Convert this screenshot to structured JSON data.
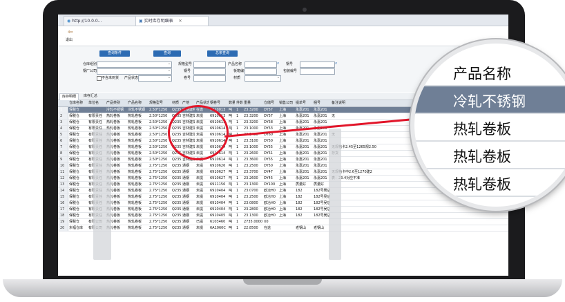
{
  "tabs": [
    {
      "label": "http://10.0.0..."
    },
    {
      "label": "实时库存明细表"
    }
  ],
  "toolbar": {
    "exit_label": "退出"
  },
  "filter": {
    "buttons": {
      "query": "查询条件",
      "search": "查询",
      "summary": "总条查询"
    },
    "labels": {
      "warehouse": "仓库组别",
      "mill": "钢厂公司",
      "spec": "规格型号",
      "product": "产品名称",
      "status": "产品状态",
      "steel_grade": "钢号",
      "coil_no": "卷号",
      "material": "材质",
      "carton": "板箱编号",
      "package": "包装编号",
      "only_available": "不含未到货"
    }
  },
  "grid": {
    "tabs": [
      "库存明细",
      "库存汇总"
    ],
    "headers": [
      "仓库名称",
      "单位名",
      "产品类别",
      "产品名称",
      "规格型号",
      "材质",
      "产地",
      "产品状态",
      "钢卷号",
      "数量",
      "件数",
      "重量",
      "仓储号",
      "销售公司",
      "提单号",
      "捆号",
      "备注说明"
    ],
    "rows": [
      [
        "保税仓",
        "",
        "冷轧不锈钢",
        "冷轧不锈钢",
        "2.50*1250",
        "Q235",
        "宝钢建邦",
        "在途",
        "6910013",
        "吨",
        "1",
        "23.3200",
        "DY57",
        "上海",
        "永嘉201",
        "永嘉201",
        ""
      ],
      [
        "保税仓",
        "有限责任",
        "热轧卷板",
        "热轧卷板",
        "2.50*1250",
        "Q235",
        "吉林建龙",
        "未提",
        "6910613",
        "吨",
        "1",
        "23.3200",
        "DY57",
        "上海",
        "永嘉201",
        "永嘉201",
        "无"
      ],
      [
        "保税仓",
        "有限责任",
        "热轧卷板",
        "热轧卷板",
        "2.50*1250",
        "Q235",
        "吉林建龙",
        "未提",
        "6910613",
        "吨",
        "1",
        "23.3200",
        "DY58",
        "上海",
        "永嘉201",
        "永嘉201",
        ""
      ],
      [
        "保税仓",
        "有限责任",
        "热轧卷板",
        "热轧卷板",
        "2.50*1250",
        "Q235",
        "吉林建龙",
        "未提",
        "6910614",
        "吨",
        "1",
        "23.1000",
        "DY53",
        "上海",
        "永嘉201",
        "永嘉201",
        ""
      ],
      [
        "保税仓",
        "有限责任",
        "热轧卷板",
        "热轧卷板",
        "2.50*1250",
        "Q235",
        "吉林建龙",
        "未提",
        "6910614",
        "吨",
        "1",
        "23.3400",
        "DY60",
        "上海",
        "永嘉201",
        "永嘉201",
        "无"
      ],
      [
        "保税仓",
        "有限责任",
        "热轧卷板",
        "热轧卷板",
        "2.50*1250",
        "Q235",
        "吉林建龙",
        "未提",
        "6910614",
        "吨",
        "1",
        "23.3100",
        "DY50",
        "上海",
        "永嘉201",
        "永嘉201",
        ""
      ],
      [
        "保税仓",
        "有限责任",
        "热轧卷板",
        "热轧卷板",
        "2.50*1250",
        "Q235",
        "吉林建龙",
        "未提",
        "6910614",
        "吨",
        "1",
        "23.1000",
        "DY55",
        "上海",
        "永嘉201",
        "永嘉201",
        "无规格卡2.45至1265规2.50"
      ],
      [
        "保税仓",
        "有限责任",
        "热轧卷板",
        "热轧卷板",
        "2.50*1250",
        "Q235",
        "吉林建龙",
        "未提",
        "6910614",
        "吨",
        "1",
        "23.2600",
        "DY51",
        "上海",
        "永嘉201",
        "永嘉201",
        "存货"
      ],
      [
        "保税仓",
        "有限责任",
        "热轧卷板",
        "热轧卷板",
        "2.50*1250",
        "Q235",
        "吉林建龙",
        "未提",
        "6910614",
        "吨",
        "1",
        "23.3600",
        "DY55",
        "上海",
        "永嘉201",
        "永嘉201",
        ""
      ],
      [
        "保税仓",
        "有限责任",
        "热轧卷板",
        "热轧卷板",
        "2.75*1250",
        "Q235",
        "通钢",
        "未提",
        "6910626",
        "吨",
        "1",
        "23.2500",
        "DY50",
        "上海",
        "永嘉201",
        "永嘉201",
        ""
      ],
      [
        "保税仓",
        "有限责任",
        "热轧卷板",
        "热轧卷板",
        "2.75*1250",
        "Q235",
        "通钢",
        "未提",
        "6910627",
        "吨",
        "1",
        "23.3700",
        "DY47",
        "上海",
        "永嘉201",
        "永嘉201",
        "无规格卡中2.6至1270建2"
      ],
      [
        "保税仓",
        "有限责任",
        "热轧卷板",
        "热轧卷板",
        "2.75*1250",
        "Q235",
        "通钢",
        "未提",
        "6910627",
        "吨",
        "1",
        "23.2600",
        "DY45",
        "上海",
        "永嘉201",
        "永嘉201",
        "表：23.4对应不准"
      ],
      [
        "保税仓",
        "有限责任",
        "热轧卷板",
        "热轧卷板",
        "2.75*1250",
        "Q235",
        "通钢",
        "未提",
        "6911156",
        "吨",
        "1",
        "23.1300",
        "DY100",
        "上海",
        "质量好",
        "质量好",
        ""
      ],
      [
        "保税仓",
        "有限责任",
        "热轧卷板",
        "热轧卷板",
        "2.75*1250",
        "Q235",
        "通钢",
        "未提",
        "6910404",
        "吨",
        "1",
        "23.0700",
        "欧冶H0",
        "上海",
        "182",
        "182号吴店",
        ""
      ],
      [
        "保税仓",
        "有限责任",
        "热轧卷板",
        "热轧卷板",
        "2.75*1250",
        "Q235",
        "通钢",
        "未提",
        "6910404",
        "吨",
        "1",
        "23.2500",
        "欧冶H0",
        "上海",
        "182",
        "182号吴店",
        ""
      ],
      [
        "保税仓",
        "有限责任",
        "热轧卷板",
        "热轧卷板",
        "2.75*1250",
        "Q235",
        "通钢",
        "未提",
        "6910404",
        "吨",
        "1",
        "23.0800",
        "欧冶H0",
        "上海",
        "182",
        "182号吴店",
        ""
      ],
      [
        "保税仓",
        "有限责任",
        "热轧卷板",
        "热轧卷板",
        "2.75*1250",
        "Q235",
        "通钢",
        "未提",
        "6910404",
        "吨",
        "1",
        "23.2800",
        "欧冶H0",
        "上海",
        "182",
        "182号吴店",
        ""
      ],
      [
        "保税仓",
        "有限责任",
        "热轧卷板",
        "热轧卷板",
        "2.75*1250",
        "Q235",
        "通钢",
        "未提",
        "6910405",
        "吨",
        "1",
        "23.1300",
        "欧冶H0",
        "上海",
        "182",
        "182号吴店",
        ""
      ],
      [
        "保税仓",
        "有限公司",
        "热轧卷板",
        "热轧卷板",
        "2.75*1250",
        "Q235",
        "通钢",
        "已提",
        "6103460",
        "吨",
        "1",
        "2735.0000",
        "X0",
        "",
        "",
        "",
        ""
      ],
      [
        "东福仓库",
        "有限公司",
        "热轧卷板",
        "热轧卷板",
        "2.75*1250",
        "Q235",
        "通钢",
        "未提",
        "6A1060C",
        "吨",
        "1",
        "22.8500",
        "在途",
        "",
        "老钢山",
        "老钢山",
        ""
      ]
    ]
  },
  "magnifier": {
    "header": "产品名称",
    "rows": [
      "冷轧不锈钢",
      "热轧卷板",
      "热轧卷板",
      "热轧卷板"
    ]
  },
  "colors": {
    "selected_row": "#6f7f96",
    "accent_button": "#2c6bb3",
    "highlight": "#e2162a"
  }
}
